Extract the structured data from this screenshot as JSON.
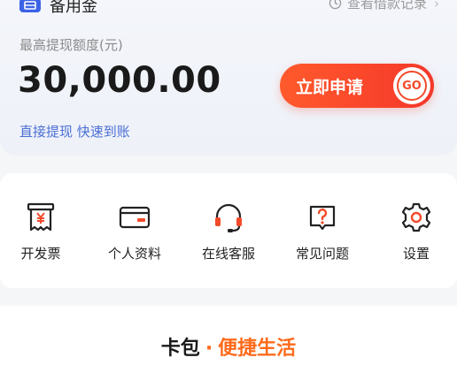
{
  "loan_card": {
    "product_name": "备用金",
    "history_link": "查看借款记录",
    "limit_label": "最高提现额度(元)",
    "amount": "30,000.00",
    "apply_button": "立即申请",
    "go_badge": "GO",
    "tagline": "直接提现 快速到账"
  },
  "shortcuts": [
    {
      "label": "开发票",
      "icon": "invoice-icon"
    },
    {
      "label": "个人资料",
      "icon": "card-icon"
    },
    {
      "label": "在线客服",
      "icon": "headset-icon"
    },
    {
      "label": "常见问题",
      "icon": "question-icon"
    },
    {
      "label": "设置",
      "icon": "gear-icon"
    }
  ],
  "section": {
    "title_part1": "卡包",
    "separator": "·",
    "title_part2": "便捷生活"
  },
  "colors": {
    "accent_red": "#f5372a",
    "link_blue": "#4a6fd6",
    "brand_blue": "#3b63e6",
    "orange": "#ff6a1a"
  }
}
